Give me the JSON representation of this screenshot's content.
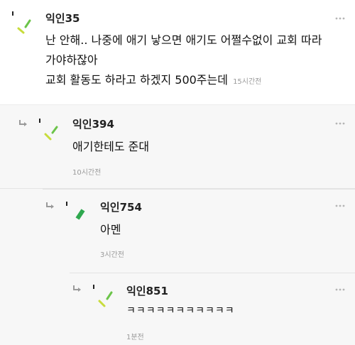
{
  "comments": [
    {
      "nickname": "익인35",
      "lines": [
        "난 안해.. 나중에 애기 낳으면 애기도 어쩔수없이 교회 따라",
        "가야하잖아",
        "교회 활동도 하라고 하겠지 500주는데"
      ],
      "time": "15시간전"
    },
    {
      "nickname": "익인394",
      "lines": [
        "애기한테도 준대"
      ],
      "time": "10시간전"
    },
    {
      "nickname": "익인754",
      "lines": [
        "아멘"
      ],
      "time": "3시간전"
    },
    {
      "nickname": "익인851",
      "lines": [
        "ㅋㅋㅋㅋㅋㅋㅋㅋㅋㅋㅋ"
      ],
      "time": "1분전"
    }
  ],
  "icons": {
    "more": "more-dots-icon",
    "reply": "reply-arrow-icon",
    "avatar": "avatar-icon"
  },
  "colors": {
    "avatar_yellow_green": "#c8dc3c",
    "avatar_green": "#6cc44a",
    "avatar_dark_green": "#2fa84f",
    "reply_bg": "#f7f7f7",
    "time_gray": "#9a9a9a"
  }
}
